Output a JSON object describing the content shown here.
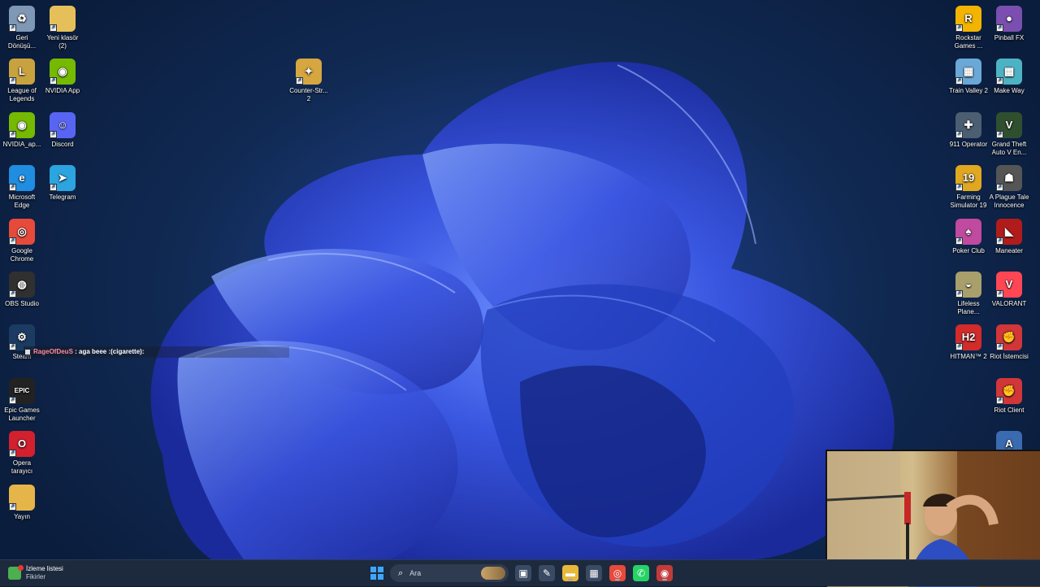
{
  "desktop": {
    "left_col1": [
      {
        "name": "recycle-bin-icon",
        "label": "Geri\nDönüşü...",
        "color": "#7f98b5",
        "glyph": "♻"
      },
      {
        "name": "league-of-legends-icon",
        "label": "League of\nLegends",
        "color": "#c8a23e",
        "glyph": "L"
      },
      {
        "name": "nvidia-app-shortcut-icon",
        "label": "NVIDIA_ap...",
        "color": "#75b900",
        "glyph": "◉"
      },
      {
        "name": "edge-icon",
        "label": "Microsoft\nEdge",
        "color": "#1f8de0",
        "glyph": "e"
      },
      {
        "name": "chrome-icon",
        "label": "Google\nChrome",
        "color": "#e64a3b",
        "glyph": "◎"
      },
      {
        "name": "obs-icon",
        "label": "OBS Studio",
        "color": "#303030",
        "glyph": "◍"
      },
      {
        "name": "steam-icon",
        "label": "Steam",
        "color": "#1b3b63",
        "glyph": "⚙"
      },
      {
        "name": "epic-games-icon",
        "label": "Epic Games\nLauncher",
        "color": "#222222",
        "glyph": "EPIC"
      },
      {
        "name": "opera-icon",
        "label": "Opera\ntarayıcı",
        "color": "#d2202f",
        "glyph": "O"
      },
      {
        "name": "folder-yayin-icon",
        "label": "Yayın",
        "color": "#e5b54a",
        "glyph": ""
      }
    ],
    "left_col2": [
      {
        "name": "new-folder-icon",
        "label": "Yeni klasör\n(2)",
        "color": "#e5c05a",
        "glyph": ""
      },
      {
        "name": "nvidia-app-icon",
        "label": "NVIDIA App",
        "color": "#75b900",
        "glyph": "◉"
      },
      {
        "name": "discord-icon",
        "label": "Discord",
        "color": "#5865f2",
        "glyph": "☺"
      },
      {
        "name": "telegram-icon",
        "label": "Telegram",
        "color": "#2ba4e0",
        "glyph": "➤"
      }
    ],
    "middle": [
      {
        "name": "counter-strike-icon",
        "label": "Counter-Str...\n2",
        "color": "#d6a640",
        "glyph": "✦"
      }
    ],
    "right_col1": [
      {
        "name": "rockstar-games-icon",
        "label": "Rockstar\nGames ...",
        "color": "#f2b400",
        "glyph": "R"
      },
      {
        "name": "train-valley-icon",
        "label": "Train Valley 2",
        "color": "#6aa8d8",
        "glyph": "▦"
      },
      {
        "name": "911-operator-icon",
        "label": "911 Operator",
        "color": "#4b5e72",
        "glyph": "✚"
      },
      {
        "name": "farming-simulator-icon",
        "label": "Farming\nSimulator 19",
        "color": "#e0a720",
        "glyph": "19"
      },
      {
        "name": "poker-club-icon",
        "label": "Poker Club",
        "color": "#c04aa0",
        "glyph": "♠"
      },
      {
        "name": "lifeless-planet-icon",
        "label": "Lifeless\nPlane...",
        "color": "#a89f6b",
        "glyph": "◒"
      },
      {
        "name": "hitman-2-icon",
        "label": "HITMAN™ 2",
        "color": "#d22b2b",
        "glyph": "H2"
      }
    ],
    "right_col2": [
      {
        "name": "pinball-fx-icon",
        "label": "Pinball FX",
        "color": "#7a4fb0",
        "glyph": "●"
      },
      {
        "name": "make-way-icon",
        "label": "Make Way",
        "color": "#4db3c4",
        "glyph": "▩"
      },
      {
        "name": "gta-v-icon",
        "label": "Grand Theft\nAuto V En...",
        "color": "#2f4f2f",
        "glyph": "V"
      },
      {
        "name": "plague-tale-icon",
        "label": "A Plague Tale\nInnocence",
        "color": "#555555",
        "glyph": "☗"
      },
      {
        "name": "maneater-icon",
        "label": "Maneater",
        "color": "#b01c1c",
        "glyph": "◣"
      },
      {
        "name": "valorant-icon",
        "label": "VALORANT",
        "color": "#ff4655",
        "glyph": "V"
      },
      {
        "name": "riot-client-icon-1",
        "label": "Riot İstemcisi",
        "color": "#d13639",
        "glyph": "✊"
      },
      {
        "name": "riot-client-icon-2",
        "label": "Riot Client",
        "color": "#d13639",
        "glyph": "✊"
      },
      {
        "name": "partial-game-icon",
        "label": "",
        "color": "#3a6ab0",
        "glyph": "A"
      }
    ]
  },
  "chat": {
    "user": "RageOfDeuS",
    "message": " : aga beee :(cigarette):"
  },
  "taskbar": {
    "widget_title": "İzleme listesi",
    "widget_subtitle": "Fikirler",
    "search_placeholder": "Ara",
    "start_icon": "windows-start-icon",
    "apps": [
      {
        "name": "task-view-icon",
        "glyph": "▣",
        "color": "#3a4a63"
      },
      {
        "name": "copilot-icon",
        "glyph": "✎",
        "color": "#3a4a63"
      },
      {
        "name": "file-explorer-icon",
        "glyph": "▬",
        "color": "#e8b83a"
      },
      {
        "name": "microsoft-store-icon",
        "glyph": "▦",
        "color": "#3a4a63"
      },
      {
        "name": "chrome-taskbar-icon",
        "glyph": "◎",
        "color": "#e64a3b"
      },
      {
        "name": "whatsapp-taskbar-icon",
        "glyph": "✆",
        "color": "#25d366"
      },
      {
        "name": "streaming-app-taskbar-icon",
        "glyph": "◉",
        "color": "#c23b3b"
      }
    ]
  }
}
